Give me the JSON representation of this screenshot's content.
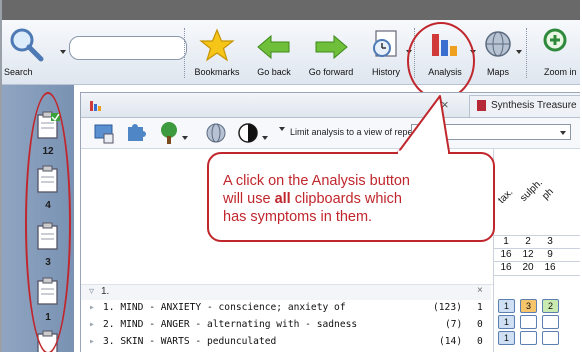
{
  "toolbar": {
    "search_label": "Search",
    "search_placeholder": "",
    "items": [
      {
        "label": "Bookmarks"
      },
      {
        "label": "Go back"
      },
      {
        "label": "Go forward"
      },
      {
        "label": "History"
      },
      {
        "label": "Analysis"
      },
      {
        "label": "Maps"
      },
      {
        "label": "Zoom in"
      }
    ]
  },
  "clipboards": [
    {
      "count": "12"
    },
    {
      "count": "4"
    },
    {
      "count": "3"
    },
    {
      "count": "1"
    }
  ],
  "window": {
    "close_glyph": "×",
    "second_tab": "Synthesis Treasure",
    "limit_label": "Limit analysis to a view of repertory",
    "repertory_value": ""
  },
  "grid": {
    "remedies": [
      "tax.",
      "sulph.",
      "ph"
    ],
    "row1": [
      "1",
      "2",
      "3"
    ],
    "row2": [
      "16",
      "12",
      "9"
    ],
    "row3": [
      "16",
      "20",
      "16"
    ],
    "cells": [
      [
        "1",
        "3",
        "2"
      ],
      [
        "1",
        "",
        ""
      ],
      [
        "1",
        "",
        ""
      ]
    ],
    "colors": {
      "cell_blue": "#cfe0f4",
      "cell_orange": "#f6c56a",
      "cell_green": "#c9eab0"
    }
  },
  "rubrics": {
    "group_label": "1.",
    "group_close": "×",
    "items": [
      {
        "text": "1. MIND - ANXIETY - conscience; anxiety of",
        "count": "(123)",
        "level": "1"
      },
      {
        "text": "2. MIND - ANGER - alternating with - sadness",
        "count": "(7)",
        "level": "0"
      },
      {
        "text": "3. SKIN - WARTS - pedunculated",
        "count": "(14)",
        "level": "0"
      }
    ]
  },
  "callout": {
    "line1": "A click on the Analysis button",
    "line2_pre": "will use ",
    "line2_bold": "all",
    "line2_post": " clipboards which",
    "line3": "has symptoms in them."
  },
  "colors": {
    "annotation_red": "#c0272d",
    "toolbar_bg": "#e6ebf2",
    "sidebar_blue": "#8399b8"
  }
}
